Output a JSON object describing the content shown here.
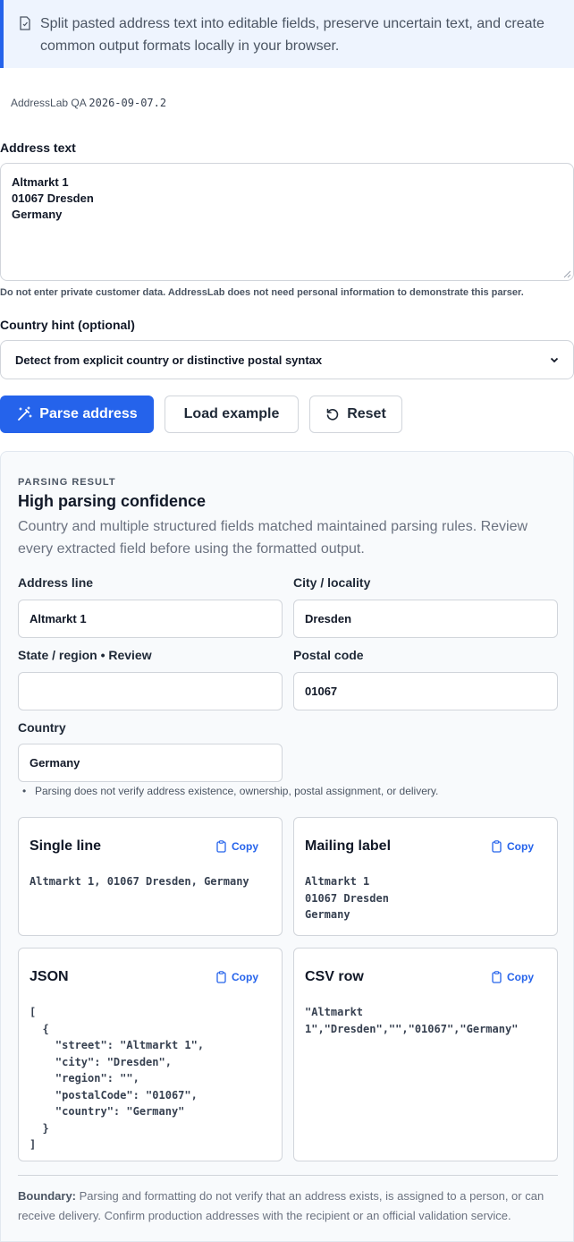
{
  "notice": {
    "text": "Split pasted address text into editable fields, preserve uncertain text, and create common output formats locally in your browser."
  },
  "version": {
    "app": "AddressLab QA",
    "build": "2026-09-07.2"
  },
  "address_input": {
    "label": "Address text",
    "value": "Altmarkt 1\n01067 Dresden\nGermany",
    "hint": "Do not enter private customer data. AddressLab does not need personal information to demonstrate this parser."
  },
  "country_hint": {
    "label": "Country hint (optional)",
    "selected": "Detect from explicit country or distinctive postal syntax"
  },
  "buttons": {
    "parse": "Parse address",
    "load": "Load example",
    "reset": "Reset"
  },
  "result": {
    "eyebrow": "PARSING RESULT",
    "title": "High parsing confidence",
    "description": "Country and multiple structured fields matched maintained parsing rules. Review every extracted field before using the formatted output.",
    "fields": {
      "address_line": {
        "label": "Address line",
        "value": "Altmarkt 1"
      },
      "city": {
        "label": "City / locality",
        "value": "Dresden"
      },
      "region": {
        "label": "State / region • Review",
        "value": ""
      },
      "postal_code": {
        "label": "Postal code",
        "value": "01067"
      },
      "country": {
        "label": "Country",
        "value": "Germany"
      }
    },
    "note": "Parsing does not verify address existence, ownership, postal assignment, or delivery.",
    "outputs": {
      "copy_label": "Copy",
      "single_line": {
        "title": "Single line",
        "body": "Altmarkt 1, 01067 Dresden, Germany"
      },
      "mailing_label": {
        "title": "Mailing label",
        "body": "Altmarkt 1\n01067 Dresden\nGermany"
      },
      "json": {
        "title": "JSON",
        "body": "[\n  {\n    \"street\": \"Altmarkt 1\",\n    \"city\": \"Dresden\",\n    \"region\": \"\",\n    \"postalCode\": \"01067\",\n    \"country\": \"Germany\"\n  }\n]"
      },
      "csv": {
        "title": "CSV row",
        "body": "\"Altmarkt\n1\",\"Dresden\",\"\",\"01067\",\"Germany\""
      }
    },
    "boundary_label": "Boundary:",
    "boundary_text": "Parsing and formatting do not verify that an address exists, is assigned to a person, or can receive delivery. Confirm production addresses with the recipient or an official validation service."
  },
  "colors": {
    "primary": "#2563eb",
    "notice_bg": "#eef4fe",
    "panel_bg": "#f8fafc"
  }
}
